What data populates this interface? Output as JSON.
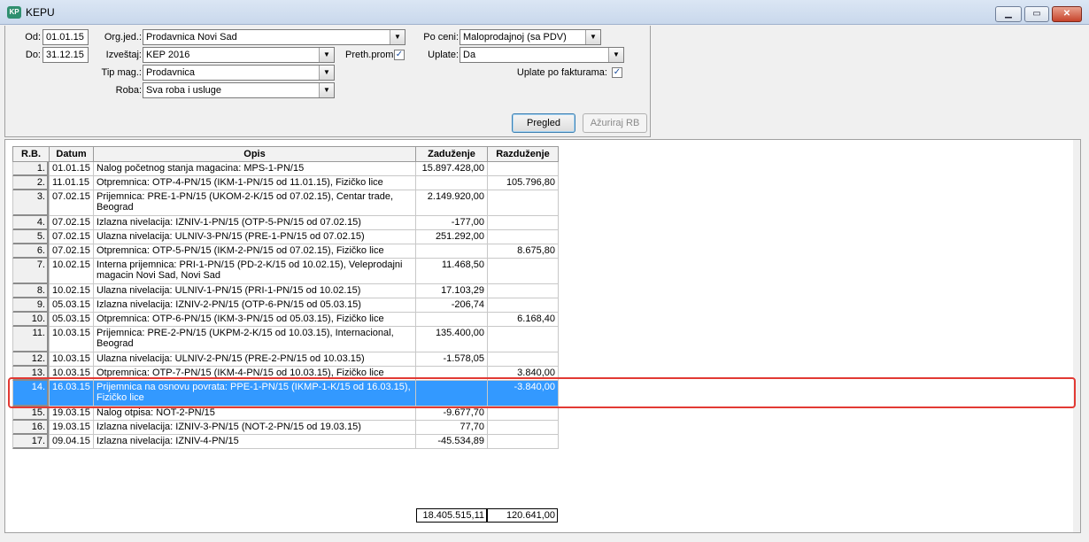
{
  "window": {
    "title": "KEPU",
    "icon_text": "KP"
  },
  "filters": {
    "od_label": "Od:",
    "od_value": "01.01.15",
    "do_label": "Do:",
    "do_value": "31.12.15",
    "org_label": "Org.jed.:",
    "org_value": "Prodavnica Novi Sad",
    "izvestaj_label": "Izveštaj:",
    "izvestaj_value": "KEP 2016",
    "tipmag_label": "Tip mag.:",
    "tipmag_value": "Prodavnica",
    "roba_label": "Roba:",
    "roba_value": "Sva roba i usluge",
    "preth_label": "Preth.prom",
    "preth_checked": "✓",
    "poceni_label": "Po ceni:",
    "poceni_value": "Maloprodajnoj (sa PDV)",
    "uplate_label": "Uplate:",
    "uplate_value": "Da",
    "uplate_fakt_label": "Uplate po fakturama:",
    "uplate_fakt_checked": "✓"
  },
  "buttons": {
    "pregled": "Pregled",
    "azuriraj": "Ažuriraj RB"
  },
  "table": {
    "headers": {
      "rb": "R.B.",
      "datum": "Datum",
      "opis": "Opis",
      "zaduzenje": "Zaduženje",
      "razduzenje": "Razduženje"
    },
    "rows": [
      {
        "rb": "1.",
        "datum": "01.01.15",
        "opis": "Nalog početnog stanja magacina: MPS-1-PN/15",
        "zaduzenje": "15.897.428,00",
        "razduzenje": ""
      },
      {
        "rb": "2.",
        "datum": "11.01.15",
        "opis": "Otpremnica: OTP-4-PN/15 (IKM-1-PN/15 od 11.01.15), Fizičko lice",
        "zaduzenje": "",
        "razduzenje": "105.796,80"
      },
      {
        "rb": "3.",
        "datum": "07.02.15",
        "opis": "Prijemnica: PRE-1-PN/15 (UKOM-2-K/15 od 07.02.15), Centar trade, Beograd",
        "zaduzenje": "2.149.920,00",
        "razduzenje": ""
      },
      {
        "rb": "4.",
        "datum": "07.02.15",
        "opis": "Izlazna nivelacija: IZNIV-1-PN/15 (OTP-5-PN/15 od 07.02.15)",
        "zaduzenje": "-177,00",
        "razduzenje": ""
      },
      {
        "rb": "5.",
        "datum": "07.02.15",
        "opis": "Ulazna nivelacija: ULNIV-3-PN/15 (PRE-1-PN/15 od 07.02.15)",
        "zaduzenje": "251.292,00",
        "razduzenje": ""
      },
      {
        "rb": "6.",
        "datum": "07.02.15",
        "opis": "Otpremnica: OTP-5-PN/15 (IKM-2-PN/15 od 07.02.15), Fizičko lice",
        "zaduzenje": "",
        "razduzenje": "8.675,80"
      },
      {
        "rb": "7.",
        "datum": "10.02.15",
        "opis": "Interna prijemnica: PRI-1-PN/15 (PD-2-K/15 od 10.02.15), Veleprodajni magacin Novi Sad, Novi Sad",
        "zaduzenje": "11.468,50",
        "razduzenje": ""
      },
      {
        "rb": "8.",
        "datum": "10.02.15",
        "opis": "Ulazna nivelacija: ULNIV-1-PN/15 (PRI-1-PN/15 od 10.02.15)",
        "zaduzenje": "17.103,29",
        "razduzenje": ""
      },
      {
        "rb": "9.",
        "datum": "05.03.15",
        "opis": "Izlazna nivelacija: IZNIV-2-PN/15 (OTP-6-PN/15 od 05.03.15)",
        "zaduzenje": "-206,74",
        "razduzenje": ""
      },
      {
        "rb": "10.",
        "datum": "05.03.15",
        "opis": "Otpremnica: OTP-6-PN/15 (IKM-3-PN/15 od 05.03.15), Fizičko lice",
        "zaduzenje": "",
        "razduzenje": "6.168,40"
      },
      {
        "rb": "11.",
        "datum": "10.03.15",
        "opis": "Prijemnica: PRE-2-PN/15 (UKPM-2-K/15 od 10.03.15), Internacional, Beograd",
        "zaduzenje": "135.400,00",
        "razduzenje": ""
      },
      {
        "rb": "12.",
        "datum": "10.03.15",
        "opis": "Ulazna nivelacija: ULNIV-2-PN/15 (PRE-2-PN/15 od 10.03.15)",
        "zaduzenje": "-1.578,05",
        "razduzenje": ""
      },
      {
        "rb": "13.",
        "datum": "10.03.15",
        "opis": "Otpremnica: OTP-7-PN/15 (IKM-4-PN/15 od 10.03.15), Fizičko lice",
        "zaduzenje": "",
        "razduzenje": "3.840,00"
      },
      {
        "rb": "14.",
        "datum": "16.03.15",
        "opis": "Prijemnica na osnovu povrata: PPE-1-PN/15 (IKMP-1-K/15 od 16.03.15), Fizičko lice",
        "zaduzenje": "",
        "razduzenje": "-3.840,00"
      },
      {
        "rb": "15.",
        "datum": "19.03.15",
        "opis": "Nalog otpisa: NOT-2-PN/15",
        "zaduzenje": "-9.677,70",
        "razduzenje": ""
      },
      {
        "rb": "16.",
        "datum": "19.03.15",
        "opis": "Izlazna nivelacija: IZNIV-3-PN/15 (NOT-2-PN/15 od 19.03.15)",
        "zaduzenje": "77,70",
        "razduzenje": ""
      },
      {
        "rb": "17.",
        "datum": "09.04.15",
        "opis": "Izlazna nivelacija: IZNIV-4-PN/15",
        "zaduzenje": "-45.534,89",
        "razduzenje": ""
      }
    ],
    "selected_row": "14.",
    "totals": {
      "zaduzenje": "18.405.515,11",
      "razduzenje": "120.641,00"
    }
  },
  "colors": {
    "selection": "#3399ff",
    "highlight_border": "#e23a34"
  }
}
